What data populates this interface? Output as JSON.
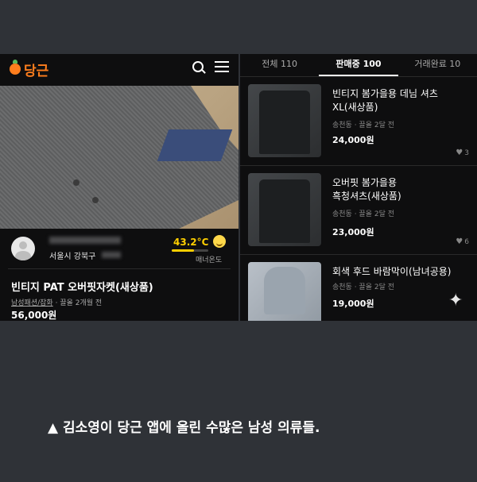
{
  "left": {
    "logo_text": "당근",
    "icons": [
      "carrot-logo-icon",
      "search-icon",
      "menu-icon"
    ],
    "seller": {
      "location": "서울시 강북구",
      "manner_temp": "43.2°C",
      "manner_label": "매너온도",
      "manner_level": 0.6
    },
    "product": {
      "title": "빈티지 PAT 오버핏자켓(새상품)",
      "category": "남성패션/잡화",
      "time": "· 끌올 2개월 전",
      "price": "56,000원"
    },
    "carousel": {
      "count": 5,
      "active": 0
    }
  },
  "right": {
    "tabs": [
      {
        "label": "전체 110",
        "active": false
      },
      {
        "label": "판매중 100",
        "active": true
      },
      {
        "label": "거래완료 10",
        "active": false
      }
    ],
    "items": [
      {
        "title_line1": "빈티지 봄가을용 데님 셔츠",
        "title_line2": "XL(새상품)",
        "meta": "송천동 · 끌올 2달 전",
        "price": "24,000원",
        "likes": "3"
      },
      {
        "title_line1": "오버핏 봄가을용",
        "title_line2": "흑청셔츠(새상품)",
        "meta": "송천동 · 끌올 2달 전",
        "price": "23,000원",
        "likes": "6"
      },
      {
        "title_line1": "회색 후드 바람막이(남녀공용)",
        "title_line2": "",
        "meta": "송천동 · 끌올 2달 전",
        "price": "19,000원",
        "likes": ""
      }
    ]
  },
  "caption": "▲ 김소영이 당근 앱에 올린 수많은 남성 의류들."
}
